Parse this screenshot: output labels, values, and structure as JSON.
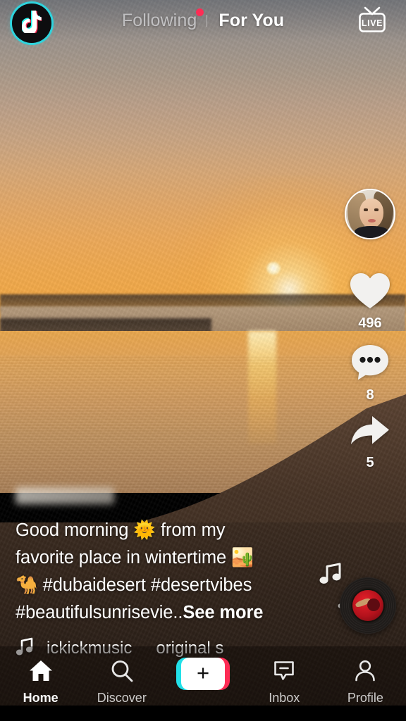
{
  "app": {
    "name": "TikTok",
    "logo_icon": "tiktok-note-icon"
  },
  "topbar": {
    "following_tab": "Following",
    "foryou_tab": "For You",
    "live_label": "LIVE",
    "live_icon": "live-tv-icon",
    "has_following_badge": true,
    "active_tab": "For You"
  },
  "video": {
    "scene": "desert sunrise over water",
    "username_redacted": true
  },
  "rail": {
    "avatar_icon": "user-avatar",
    "like": {
      "icon": "heart-icon",
      "count": "496"
    },
    "comment": {
      "icon": "comment-bubble-icon",
      "count": "8"
    },
    "share": {
      "icon": "share-arrow-icon",
      "count": "5"
    },
    "disc_icon": "spinning-record-icon",
    "floating_note_icon": "music-note-icon"
  },
  "caption": {
    "line1": "Good morning 🌞 from my",
    "line2": "favorite place in wintertime 🏜️",
    "line3": "🐪 #dubaidesert #desertvibes",
    "line4_text": "#beautifulsunrisevie..",
    "see_more": "See more"
  },
  "music": {
    "note_icon": "music-note-icon",
    "track_part1": "ickickmusic",
    "track_part2": "original s"
  },
  "bottom_nav": {
    "items": [
      {
        "label": "Home",
        "icon": "home-icon",
        "active": true
      },
      {
        "label": "Discover",
        "icon": "search-icon",
        "active": false
      },
      {
        "label": "Inbox",
        "icon": "inbox-icon",
        "active": false
      },
      {
        "label": "Profile",
        "icon": "person-icon",
        "active": false
      }
    ],
    "create_icon": "plus-icon"
  },
  "colors": {
    "brand_cyan": "#22e0e8",
    "brand_pink": "#fe2c55",
    "text_white": "#ffffff",
    "inactive_tab": "#bcbcbe"
  }
}
